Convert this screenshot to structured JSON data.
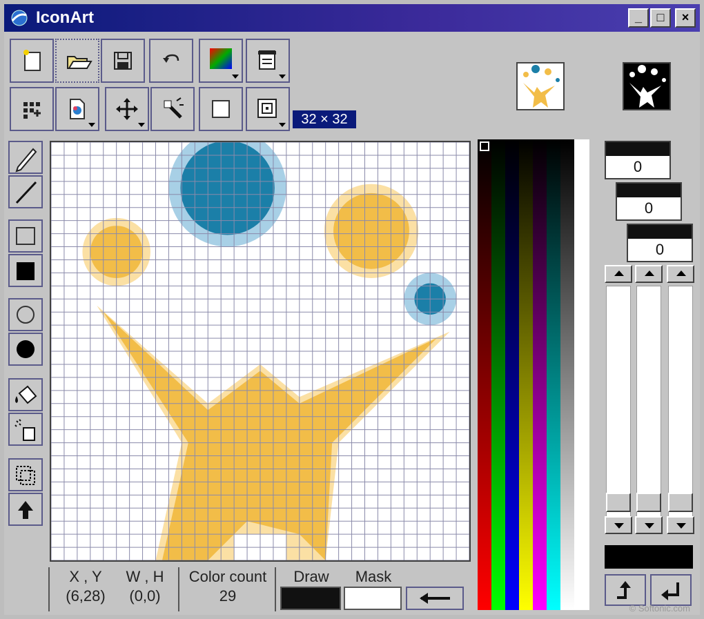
{
  "window": {
    "title": "IconArt",
    "minimize": "_",
    "maximize": "□",
    "close": "×"
  },
  "toolbar": {
    "row1": [
      "new-icon",
      "open-folder-icon",
      "save-icon",
      "undo-icon",
      "palette-gradient-icon",
      "clipboard-icon"
    ],
    "row2": [
      "add-pixels-icon",
      "image-import-icon",
      "move-icon",
      "magic-wand-icon",
      "square-icon",
      "target-square-icon"
    ],
    "size_label": "32 × 32"
  },
  "tools": [
    "pencil-icon",
    "line-icon",
    "rect-outline-icon",
    "rect-filled-icon",
    "ellipse-outline-icon",
    "ellipse-filled-icon",
    "fill-bucket-icon",
    "spray-icon",
    "select-icon",
    "shift-up-icon"
  ],
  "status": {
    "xy_label": "X , Y",
    "xy_value": "(6,28)",
    "wh_label": "W , H",
    "wh_value": "(0,0)",
    "colorcount_label": "Color count",
    "colorcount_value": "29",
    "draw_label": "Draw",
    "mask_label": "Mask",
    "draw_color": "#111111",
    "mask_color": "#ffffff"
  },
  "rgb": {
    "values": [
      "0",
      "0",
      "0"
    ]
  },
  "colors": {
    "yellow": "#f2bd48",
    "light_yellow": "#fbe0a4",
    "blue": "#1b7fa8",
    "light_blue": "#a8d0e6",
    "title_bar": "#0a1a7a"
  },
  "watermark": "© Softonic.com"
}
